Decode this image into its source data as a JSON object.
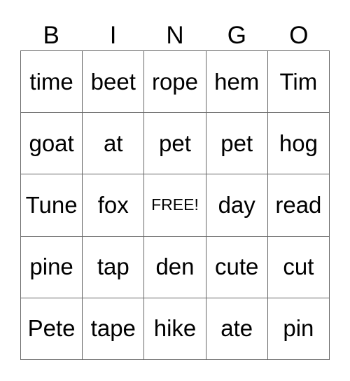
{
  "card": {
    "header": [
      "B",
      "I",
      "N",
      "G",
      "O"
    ],
    "rows": [
      [
        "time",
        "beet",
        "rope",
        "hem",
        "Tim"
      ],
      [
        "goat",
        "at",
        "pet",
        "pet",
        "hog"
      ],
      [
        "Tune",
        "fox",
        "FREE!",
        "day",
        "read"
      ],
      [
        "pine",
        "tap",
        "den",
        "cute",
        "cut"
      ],
      [
        "Pete",
        "tape",
        "hike",
        "ate",
        "pin"
      ]
    ]
  }
}
